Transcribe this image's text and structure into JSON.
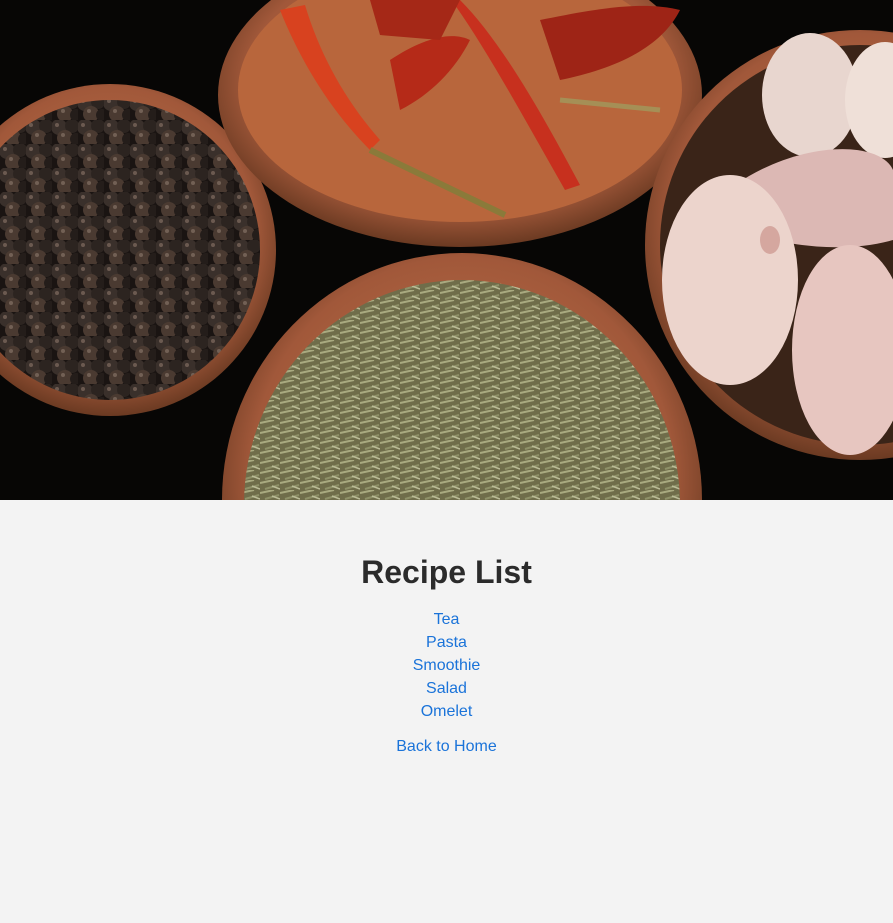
{
  "hero": {
    "image": "spice-bowls-photo",
    "colors": {
      "background": "#070605",
      "bowl": "#a8603a",
      "peppercorn": "#2e2622",
      "chili": "#c8301c",
      "rosemary": "#8d8f63",
      "garlic": "#e9d2cc"
    }
  },
  "page": {
    "title": "Recipe List",
    "recipes": [
      {
        "label": "Tea"
      },
      {
        "label": "Pasta"
      },
      {
        "label": "Smoothie"
      },
      {
        "label": "Salad"
      },
      {
        "label": "Omelet"
      }
    ],
    "back_link": "Back to Home",
    "colors": {
      "page_background": "#f3f3f3",
      "title": "#2b2b2b",
      "link": "#1a73d9"
    }
  }
}
